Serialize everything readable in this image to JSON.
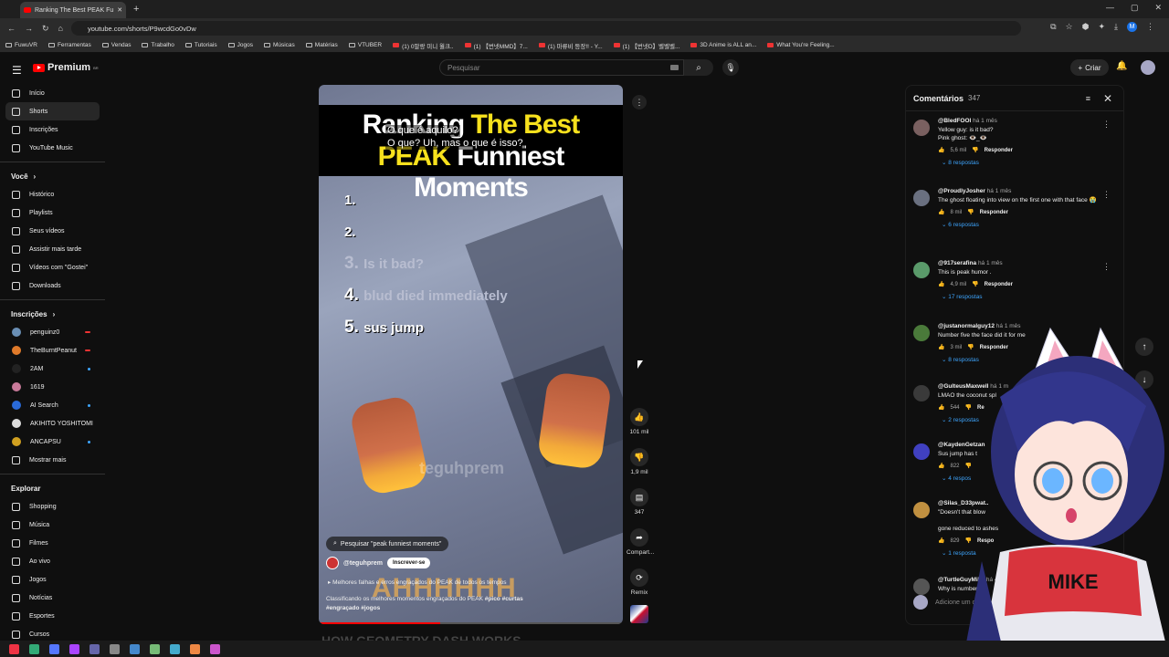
{
  "browser": {
    "tab_title": "Ranking The Best PEAK Fu",
    "url": "youtube.com/shorts/P9wcdGo0vDw",
    "bookmarks": [
      "FuwuVR",
      "Ferramentas",
      "Vendas",
      "Trabalho",
      "Tutoriais",
      "Jogos",
      "Músicas",
      "Matérias",
      "VTUBER",
      "(1) 0말랑 미니 월크..",
      "(1) 【번넷MMD】7...",
      "(1) 마류비 등장!! - Y...",
      "(1) 【번넷D】벨벨벨...",
      "3D Anime is ALL an...",
      "What You're Feeling..."
    ]
  },
  "header": {
    "logo": "Premium",
    "logo_sup": "BR",
    "search_placeholder": "Pesquisar",
    "create_label": "Criar"
  },
  "sidebar": {
    "main": [
      {
        "label": "Início",
        "icon": "home-icon"
      },
      {
        "label": "Shorts",
        "icon": "shorts-icon",
        "active": true
      },
      {
        "label": "Inscrições",
        "icon": "subscriptions-icon"
      },
      {
        "label": "YouTube Music",
        "icon": "music-icon"
      }
    ],
    "you_heading": "Você",
    "you": [
      {
        "label": "Histórico",
        "icon": "history-icon"
      },
      {
        "label": "Playlists",
        "icon": "playlists-icon"
      },
      {
        "label": "Seus vídeos",
        "icon": "your-videos-icon"
      },
      {
        "label": "Assistir mais tarde",
        "icon": "watch-later-icon"
      },
      {
        "label": "Vídeos com \"Gostei\"",
        "icon": "liked-icon"
      },
      {
        "label": "Downloads",
        "icon": "download-icon"
      }
    ],
    "subs_heading": "Inscrições",
    "subs": [
      {
        "label": "penguinz0",
        "color": "#6a8fb5",
        "status": "live"
      },
      {
        "label": "TheBurntPeanut",
        "color": "#e07a2a",
        "status": "live"
      },
      {
        "label": "2AM",
        "color": "#222222",
        "status": "dot"
      },
      {
        "label": "1619",
        "color": "#c97a9a",
        "status": ""
      },
      {
        "label": "AI Search",
        "color": "#2a6ad8",
        "status": "dot"
      },
      {
        "label": "AKIHITO YOSHITOMI",
        "color": "#dddddd",
        "status": ""
      },
      {
        "label": "ANCAPSU",
        "color": "#d0a020",
        "status": "dot"
      }
    ],
    "show_more": "Mostrar mais",
    "explore_heading": "Explorar",
    "explore": [
      {
        "label": "Shopping",
        "icon": "shopping-icon"
      },
      {
        "label": "Música",
        "icon": "music-note-icon"
      },
      {
        "label": "Filmes",
        "icon": "film-icon"
      },
      {
        "label": "Ao vivo",
        "icon": "live-icon"
      },
      {
        "label": "Jogos",
        "icon": "gaming-icon"
      },
      {
        "label": "Notícias",
        "icon": "news-icon"
      },
      {
        "label": "Esportes",
        "icon": "trophy-icon"
      },
      {
        "label": "Cursos",
        "icon": "courses-icon"
      }
    ]
  },
  "video": {
    "title_line1_a": "Ranking",
    "title_line1_b": "The Best",
    "title_line2_a": "PEAK",
    "title_line2_b": "Funniest Moments",
    "subtitle1": "O que é aquilo?",
    "subtitle2": "O que?  Uh, mas o que é isso?",
    "rank1": "1.",
    "rank2": "2.",
    "rank3": "3.",
    "rank3_text": "Is it bad?",
    "rank4": "4.",
    "rank4_text": "blud died immediately",
    "rank5": "5.",
    "rank5_text": "sus jump",
    "watermark": "teguhprem",
    "ahh": "AHHHHHH",
    "search_pill": "Pesquisar \"peak funniest moments\"",
    "channel": "@teguhprem",
    "subscribe": "Inscrever-se",
    "desc1": "Melhores falhas e erros engraçados do PEAK de todos os tempos",
    "desc2": "Classificando os melhores momentos engraçados do PEAK",
    "tags": "#pico #curtas #engraçado #jogos",
    "progress": 0.4
  },
  "actions": {
    "likes": "101 mil",
    "dislikes": "1,9 mil",
    "comments": "347",
    "share": "Compart...",
    "remix": "Remix"
  },
  "comments_panel": {
    "title": "Comentários",
    "count": "347",
    "add_placeholder": "Adicione um com",
    "items": [
      {
        "user": "@BledFOOl",
        "time": "há 1 mês",
        "text": "Yellow guy: is it bad?\nPink ghost: 👁️_👁️",
        "likes": "5,6 mil",
        "reply": "Responder",
        "replies": "8 respostas",
        "color": "#7a6060"
      },
      {
        "user": "@ProudlyJosher",
        "time": "há 1 mês",
        "text": "The ghost floating into view on the first one with that face 😭",
        "likes": "8 mil",
        "reply": "Responder",
        "replies": "6 respostas",
        "color": "#6a7080"
      },
      {
        "user": "@917serafina",
        "time": "há 1 mês",
        "text": "This is peak humor .",
        "likes": "4,9 mil",
        "reply": "Responder",
        "replies": "17 respostas",
        "color": "#5a9a6a"
      },
      {
        "user": "@justanormalguy12",
        "time": "há 1 mês",
        "text": "Number five the face did it for me",
        "likes": "3 mil",
        "reply": "Responder",
        "replies": "8 respostas",
        "color": "#4a7a3a"
      },
      {
        "user": "@GulteusMaxwell",
        "time": "há 1 m",
        "text": "LMAO the coconut spl",
        "likes": "544",
        "reply": "Re",
        "replies": "2 respostas",
        "color": "#3a3a3a"
      },
      {
        "user": "@KaydenGetzan",
        "time": "",
        "text": "Sus jump has t",
        "likes": "822",
        "reply": "",
        "replies": "4 respos",
        "color": "#4040c0"
      },
      {
        "user": "@Silas_D33pwat..",
        "time": "",
        "text": "\"Doesn't that blow\n\ngone reduced to ashes",
        "likes": "829",
        "reply": "Respo",
        "replies": "1 resposta",
        "color": "#c09040"
      },
      {
        "user": "@TurtleGuyMike",
        "time": "há 4",
        "text": "Why is number five",
        "likes": "",
        "reply": "",
        "replies": "",
        "color": "#555555"
      }
    ]
  },
  "below_title": "HOW GEOMETRY DASH WORKS"
}
